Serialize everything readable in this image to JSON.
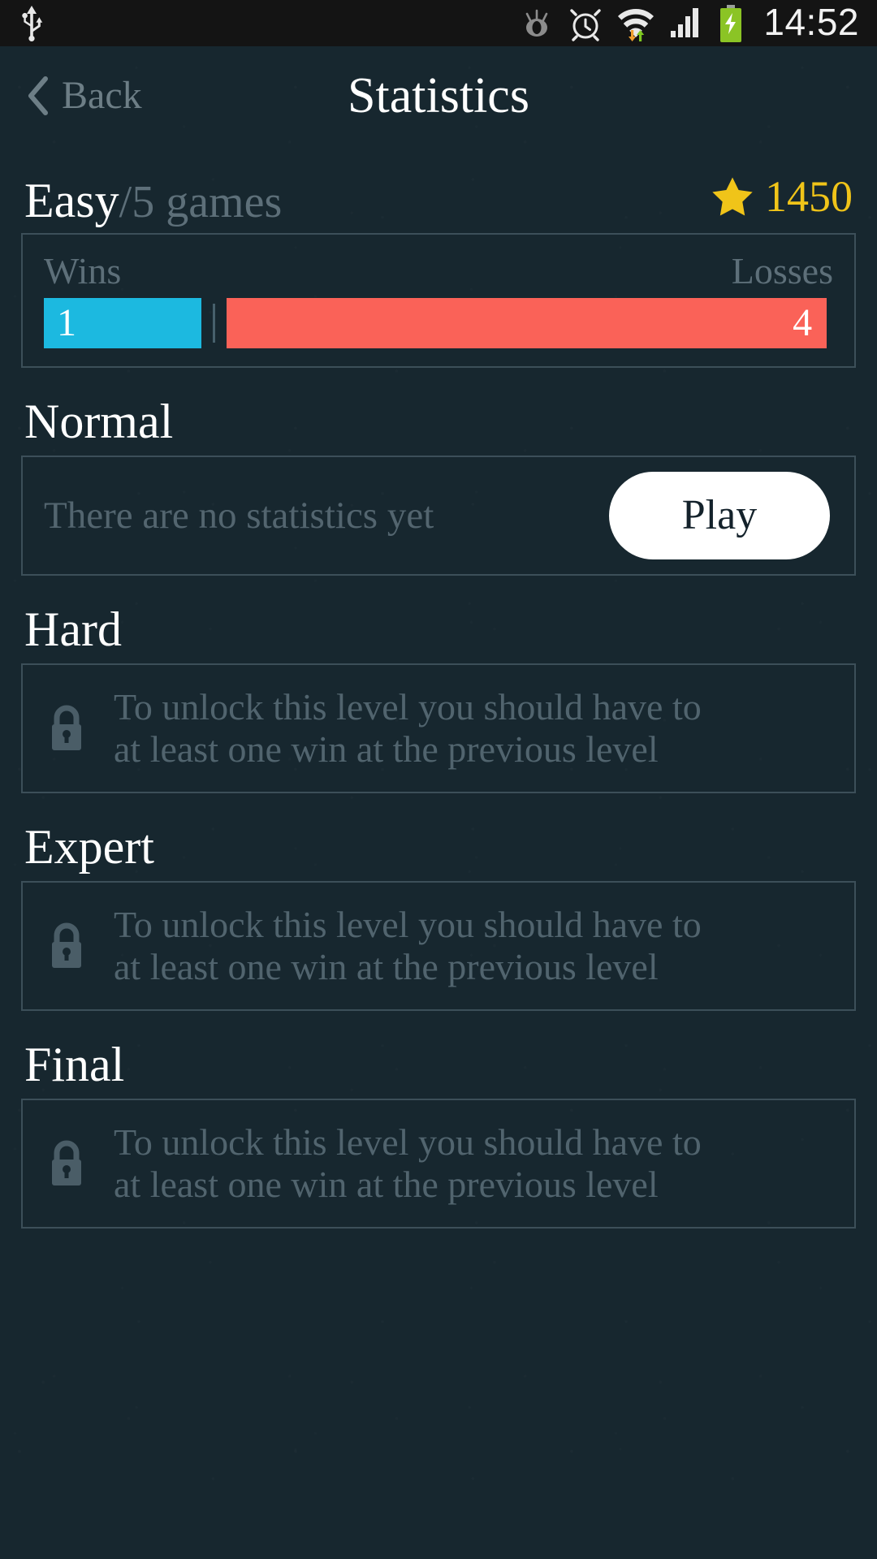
{
  "statusbar": {
    "time": "14:52",
    "icons": [
      "usb-icon",
      "eye-icon",
      "alarm-clock-icon",
      "wifi-icon",
      "signal-bars-icon",
      "battery-charging-icon"
    ]
  },
  "header": {
    "back_label": "Back",
    "title": "Statistics"
  },
  "colors": {
    "background": "#17272f",
    "card_border": "#3c4f59",
    "wins_bar": "#1cb9e0",
    "losses_bar": "#fa6258",
    "star": "#f0c419",
    "muted_text": "#5d6f79",
    "white_text": "#ffffff"
  },
  "levels": [
    {
      "name": "Easy",
      "games_suffix": "/5 games",
      "score": "1450",
      "state": "played",
      "stats": {
        "wins_label": "Wins",
        "losses_label": "Losses",
        "wins": "1",
        "losses": "4",
        "wins_pct": 20,
        "losses_pct": 80
      }
    },
    {
      "name": "Normal",
      "state": "empty",
      "empty_text": "There are no statistics yet",
      "play_label": "Play"
    },
    {
      "name": "Hard",
      "state": "locked",
      "locked_line1": "To unlock this level you should have to",
      "locked_line2": "at least one win at the previous level"
    },
    {
      "name": "Expert",
      "state": "locked",
      "locked_line1": "To unlock this level you should have to",
      "locked_line2": "at least one win at the previous level"
    },
    {
      "name": "Final",
      "state": "locked",
      "locked_line1": "To unlock this level you should have to",
      "locked_line2": "at least one win at the previous level"
    }
  ]
}
